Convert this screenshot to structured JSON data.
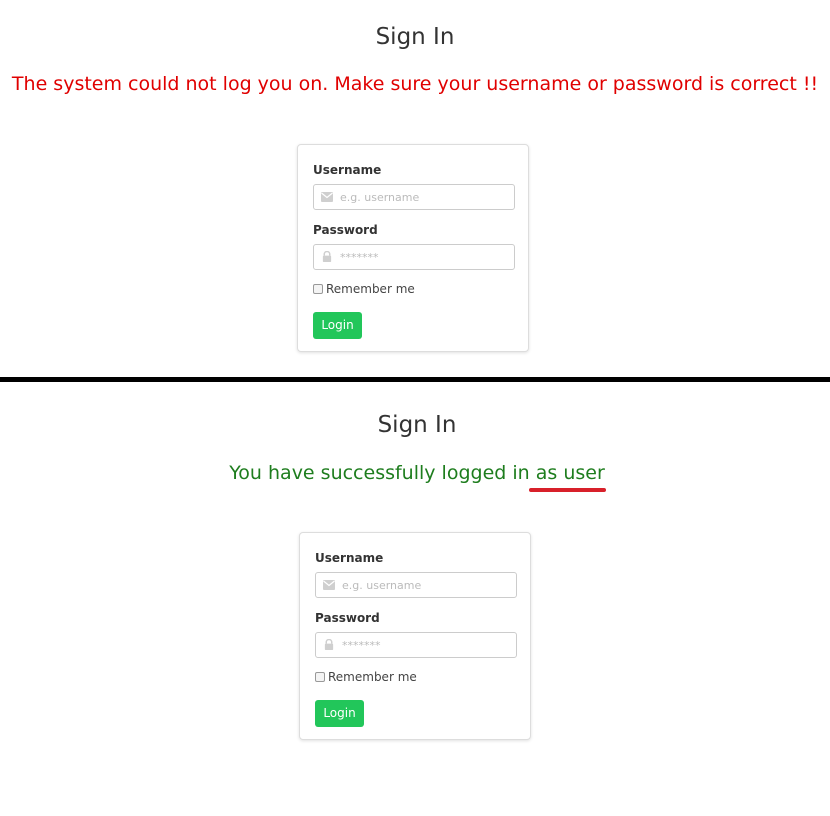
{
  "colors": {
    "error_text": "#e00000",
    "success_text": "#1e7d1e",
    "highlight_underline": "#d8202a",
    "login_button": "#22c65a",
    "divider": "#000000"
  },
  "failed_login": {
    "title": "Sign In",
    "message": "The system could not log you on. Make sure your username or password is correct !!",
    "form": {
      "username_label": "Username",
      "username_placeholder": "e.g. username",
      "username_icon": "envelope-icon",
      "password_label": "Password",
      "password_placeholder": "*******",
      "password_icon": "lock-icon",
      "remember_label": "Remember me",
      "remember_checked": false,
      "login_label": "Login"
    }
  },
  "successful_login": {
    "title": "Sign In",
    "message": "You have successfully logged in as user",
    "form": {
      "username_label": "Username",
      "username_placeholder": "e.g. username",
      "username_icon": "envelope-icon",
      "password_label": "Password",
      "password_placeholder": "*******",
      "password_icon": "lock-icon",
      "remember_label": "Remember me",
      "remember_checked": false,
      "login_label": "Login"
    }
  }
}
